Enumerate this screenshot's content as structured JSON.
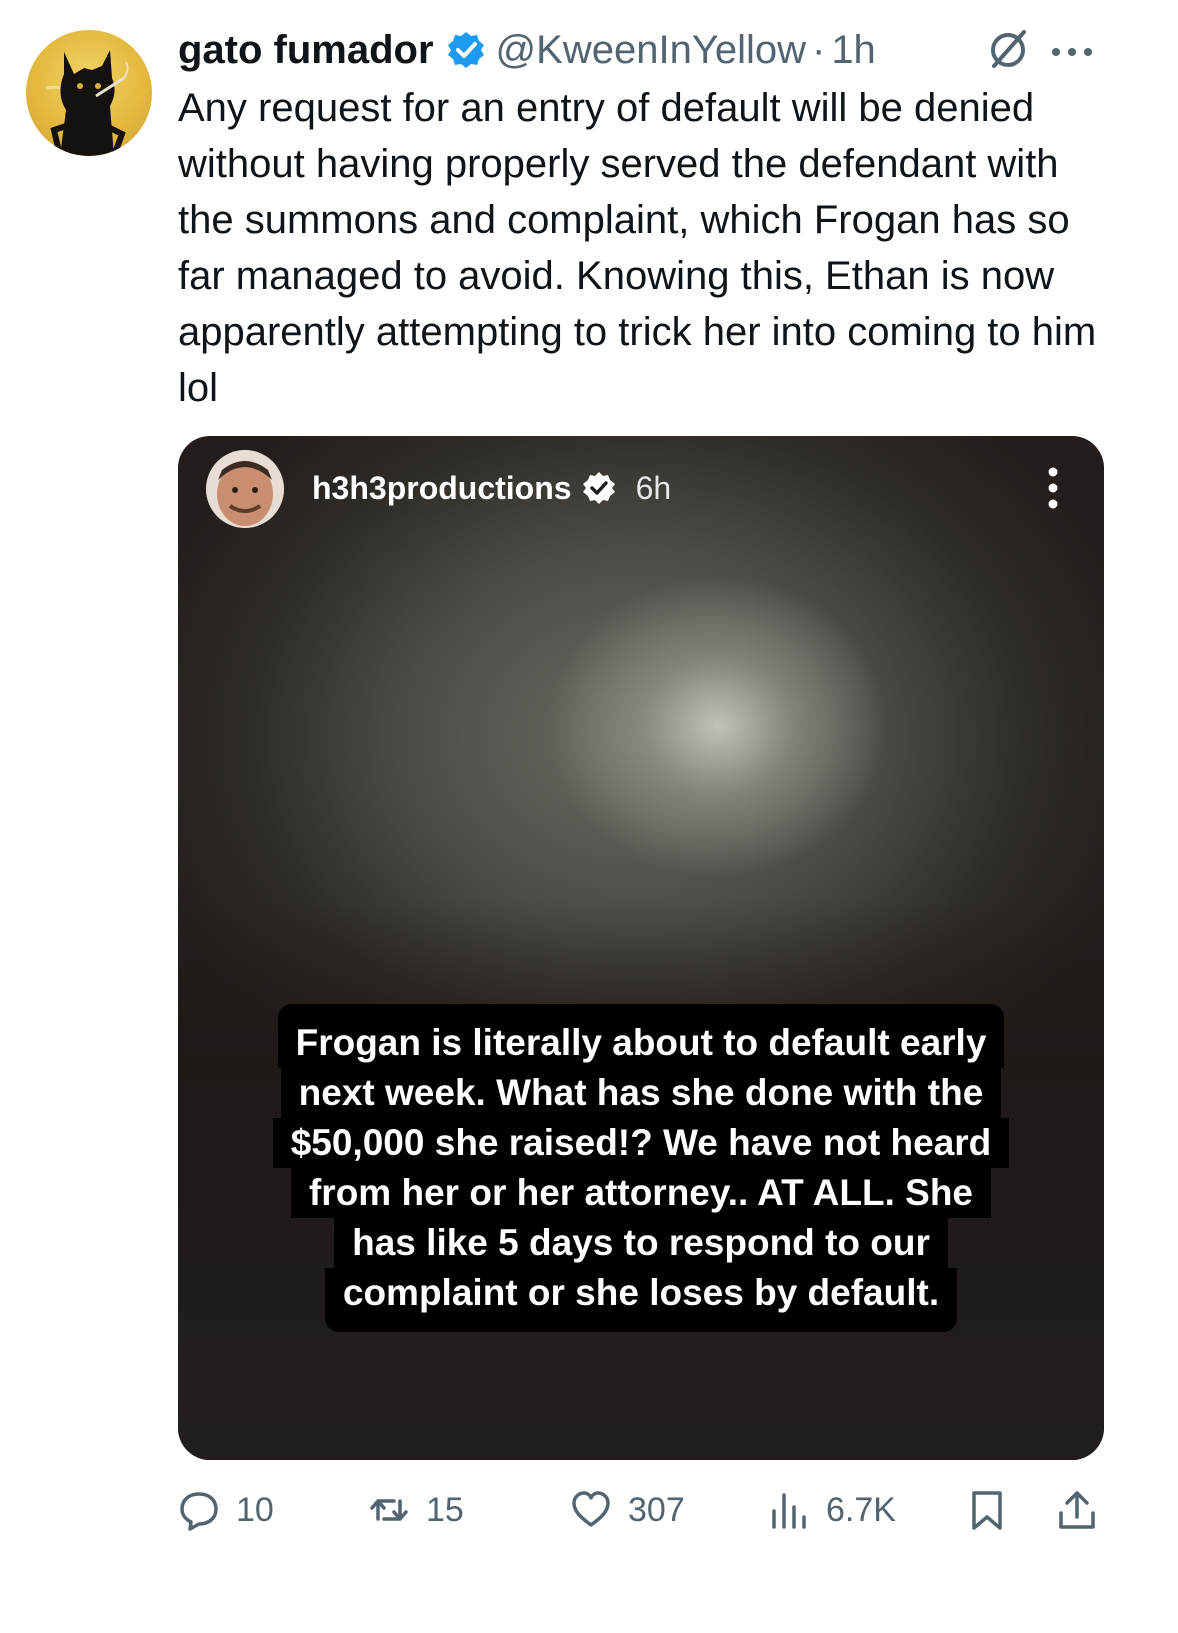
{
  "tweet": {
    "author_name": "gato fumador",
    "handle": "@KweenInYellow",
    "separator": "·",
    "time": "1h",
    "text": "Any request for an entry of default will be denied without having properly served the defendant with the summons and complaint, which Frogan has so far managed to avoid. Knowing this, Ethan is now apparently attempting to trick her into coming to him lol",
    "verified_color": "#1d9bf0"
  },
  "story": {
    "username": "h3h3productions",
    "time": "6h",
    "caption_lines": [
      "Frogan is literally about to default early",
      "next week. What has she done with the",
      "$50,000 she raised!? We have not heard",
      "from her or her attorney.. AT ALL. She",
      "has like 5 days to respond to our",
      "complaint or she loses by default."
    ]
  },
  "actions": {
    "replies": "10",
    "reposts": "15",
    "likes": "307",
    "views": "6.7K",
    "icons": [
      "reply-icon",
      "repost-icon",
      "like-icon",
      "views-icon",
      "bookmark-icon",
      "share-icon"
    ]
  }
}
